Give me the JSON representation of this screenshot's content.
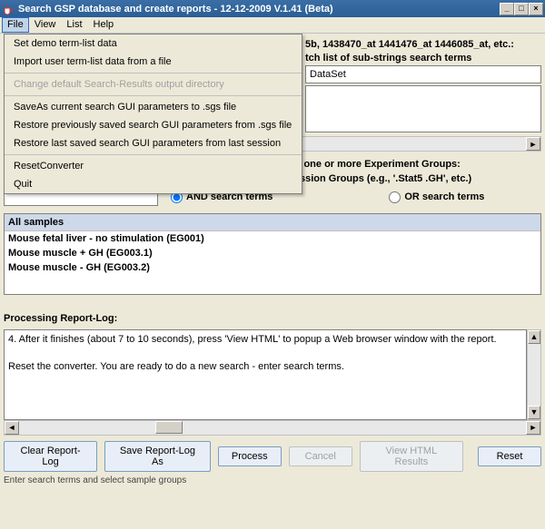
{
  "window": {
    "title": "Search GSP database and create reports - 12-12-2009 V.1.41 (Beta)"
  },
  "menubar": {
    "file": "File",
    "view": "View",
    "list": "List",
    "help": "Help"
  },
  "file_menu": {
    "set_demo": "Set demo term-list data",
    "import_terms": "Import user term-list data from a file",
    "change_dir": "Change default Search-Results output directory",
    "saveas_sgs": "SaveAs current search GUI parameters to .sgs file",
    "restore_prev": "Restore previously saved search GUI parameters from .sgs file",
    "restore_last": "Restore last saved search GUI parameters from last session",
    "reset_conv": "ResetConverter",
    "quit": "Quit"
  },
  "step1": {
    "hint_fragment": "5b, 1438470_at 1441476_at 1446085_at, etc.:",
    "match_hint_fragment": "tch list of sub-strings search terms",
    "dataset_value": "DataSet"
  },
  "step2": {
    "line": "2. Select one or more 'Sample Experiment Groups'. E.g., select one or more Experiment Groups:",
    "filterline": "Filter further by optional AND/OR search sub-strings for Expression Groups (e.g., '.Stat5 .GH', etc.)",
    "and_label": "AND search terms",
    "or_label": "OR search terms"
  },
  "samples": {
    "header": "All samples",
    "rows": [
      "Mouse fetal liver - no stimulation (EG001)",
      "Mouse muscle + GH (EG003.1)",
      "Mouse muscle - GH (EG003.2)"
    ]
  },
  "processing": {
    "label": "Processing Report-Log:",
    "line1": "4. After it finishes (about 7 to 10 seconds), press 'View HTML' to popup a Web browser window with the report.",
    "line2": "Reset the converter. You are ready to do a new search - enter search terms."
  },
  "buttons": {
    "clear": "Clear Report-Log",
    "savelog": "Save Report-Log As",
    "process": "Process",
    "cancel": "Cancel",
    "viewhtml": "View HTML Results",
    "reset": "Reset"
  },
  "status": "Enter search terms and select sample groups"
}
